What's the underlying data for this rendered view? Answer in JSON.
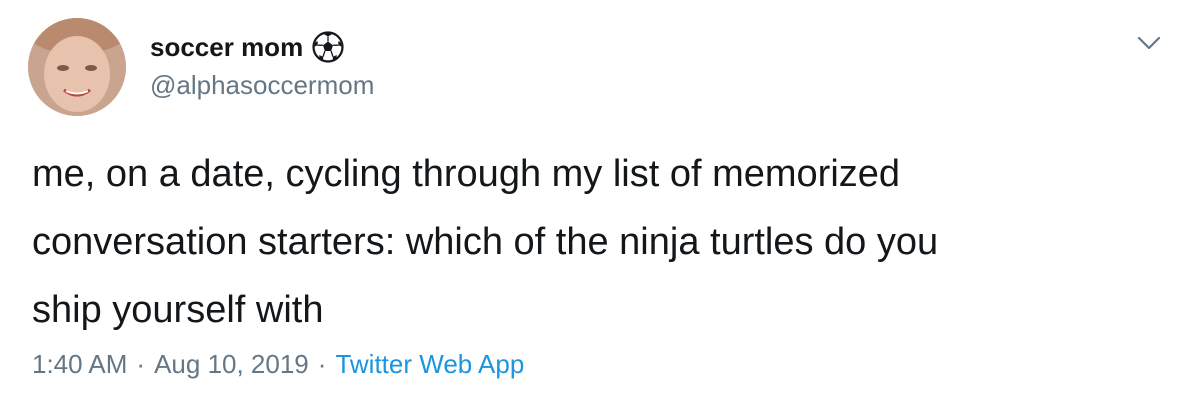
{
  "author": {
    "display_name": "soccer mom",
    "handle": "@alphasoccermom",
    "name_emoji_icon": "soccer-ball-icon",
    "avatar": "profile-photo"
  },
  "menu": {
    "icon": "chevron-down-icon"
  },
  "tweet": {
    "text": "me, on a date, cycling through my list of memorized\nconversation starters: which of the ninja turtles do you\nship yourself with"
  },
  "meta": {
    "time": "1:40 AM",
    "separator": "·",
    "date": "Aug 10, 2019",
    "source": "Twitter Web App"
  },
  "colors": {
    "text_primary": "#14171a",
    "text_secondary": "#657786",
    "link": "#1b95e0"
  }
}
